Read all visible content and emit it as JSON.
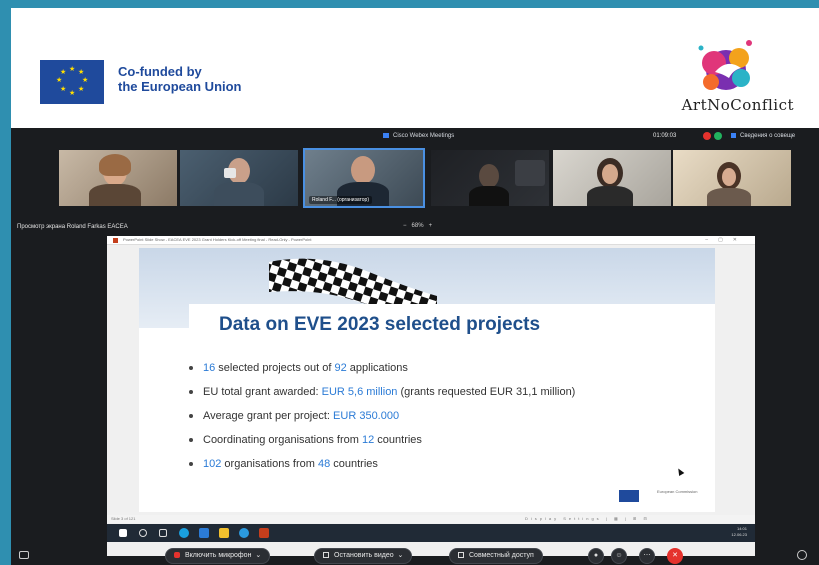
{
  "header": {
    "eu_line1": "Co-funded by",
    "eu_line2": "the European Union",
    "logo_text": "ArtNoConflict",
    "colors": {
      "eu_blue": "#1f4a9c",
      "eu_star": "#ffdd00"
    }
  },
  "meeting": {
    "app_title": "Cisco Webex Meetings",
    "elapsed_time": "01:09:03",
    "info_label": "Сведения о совеще",
    "participant_name": "Roland F...",
    "participant_role": "(организатор)",
    "share_label": "Просмотр экрана Roland Farkas EACEA",
    "zoom_level": "68%",
    "zoom_minus": "−",
    "zoom_plus": "+"
  },
  "powerpoint": {
    "window_title": "PowerPoint Slide Show  -  EACEA EVE 2023 Grant Holders Kick-off Meeting final  -  Read-Only  -  PowerPoint",
    "status_left": "Slide 3 of 121",
    "status_right": "Display Settings  |  ▦  |  ⊞  ⊟",
    "clock_time": "14:01",
    "clock_date": "12.06.23"
  },
  "slide": {
    "title": "Data on EVE 2023 selected projects",
    "bullets": [
      {
        "pre": "",
        "hl1": "16",
        "mid": " selected projects out of ",
        "hl2": "92",
        "post": " applications"
      },
      {
        "pre": "EU total grant awarded: ",
        "hl1": "EUR 5,6 million",
        "mid": " (grants requested EUR 31,1 million)",
        "hl2": "",
        "post": ""
      },
      {
        "pre": "Average grant per project: ",
        "hl1": "EUR 350.000",
        "mid": "",
        "hl2": "",
        "post": ""
      },
      {
        "pre": "Coordinating organisations from ",
        "hl1": "12",
        "mid": " countries",
        "hl2": "",
        "post": ""
      },
      {
        "pre": "",
        "hl1": "102",
        "mid": " organisations from ",
        "hl2": "48",
        "post": " countries"
      }
    ],
    "ec_logo_text": "European Commission",
    "colors": {
      "title": "#1f4f8b",
      "highlight": "#2b7bd6"
    }
  },
  "controls": {
    "mic_label": "Включить микрофон",
    "video_label": "Остановить видео",
    "share_label": "Совместный доступ",
    "end_color": "#e5322d"
  }
}
